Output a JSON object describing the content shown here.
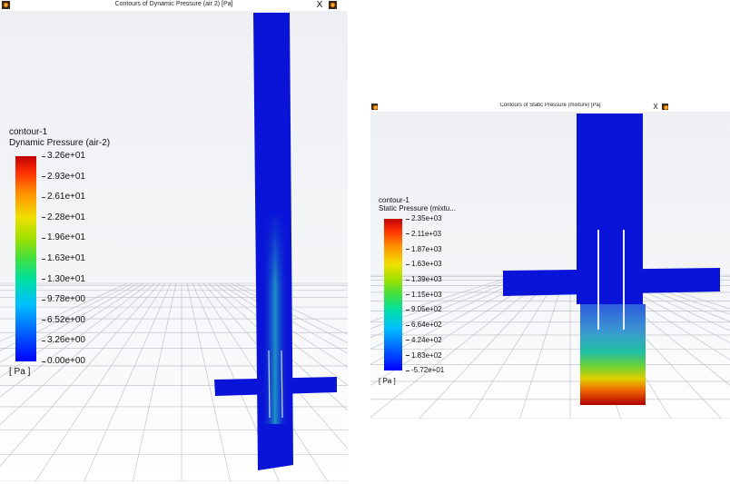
{
  "left_window": {
    "title": "Contours of Dynamic Pressure (air 2)  [Pa]",
    "close_label": "X",
    "legend": {
      "contour_name": "contour-1",
      "variable": "Dynamic Pressure (air-2)",
      "unit": "[ Pa ]",
      "tick_labels": [
        "3.26e+01",
        "2.93e+01",
        "2.61e+01",
        "2.28e+01",
        "1.96e+01",
        "1.63e+01",
        "1.30e+01",
        "9.78e+00",
        "6.52e+00",
        "3.26e+00",
        "0.00e+00"
      ]
    }
  },
  "right_window": {
    "title": "Contours of Static Pressure (mixture)  [Pa]",
    "close_label": "X",
    "legend": {
      "contour_name": "contour-1",
      "variable": "Static Pressure (mixtu...",
      "unit": "[ Pa ]",
      "tick_labels": [
        "2.35e+03",
        "2.11e+03",
        "1.87e+03",
        "1.63e+03",
        "1.39e+03",
        "1.15e+03",
        "9.05e+02",
        "6.64e+02",
        "4.24e+02",
        "1.83e+02",
        "-5.72e+01"
      ]
    }
  },
  "colors": {
    "geometry_blue": "#0a14d8",
    "low": "#0000ff",
    "high": "#c00000"
  }
}
